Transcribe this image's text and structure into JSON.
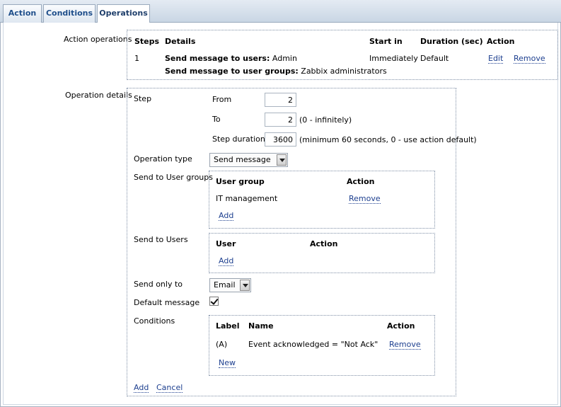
{
  "tabs": [
    {
      "label": "Action"
    },
    {
      "label": "Conditions"
    },
    {
      "label": "Operations"
    }
  ],
  "action_operations": {
    "label": "Action operations",
    "headers": {
      "steps": "Steps",
      "details": "Details",
      "start_in": "Start in",
      "duration": "Duration (sec)",
      "action": "Action"
    },
    "rows": [
      {
        "step": "1",
        "details_users_label": "Send message to users:",
        "details_users_value": "Admin",
        "details_groups_label": "Send message to user groups:",
        "details_groups_value": "Zabbix administrators",
        "start_in": "Immediately",
        "duration": "Default",
        "edit_label": "Edit",
        "remove_label": "Remove"
      }
    ]
  },
  "operation_details": {
    "label": "Operation details",
    "step_label": "Step",
    "from_label": "From",
    "from_value": "2",
    "to_label": "To",
    "to_value": "2",
    "to_hint": "(0 - infinitely)",
    "step_duration_label": "Step duration",
    "step_duration_value": "3600",
    "step_duration_hint": "(minimum 60 seconds, 0 - use action default)",
    "operation_type_label": "Operation type",
    "operation_type_value": "Send message",
    "send_to_user_groups_label": "Send to User groups",
    "user_groups": {
      "headers": {
        "group": "User group",
        "action": "Action"
      },
      "rows": [
        {
          "name": "IT management",
          "remove_label": "Remove"
        }
      ],
      "add_label": "Add"
    },
    "send_to_users_label": "Send to Users",
    "users": {
      "headers": {
        "user": "User",
        "action": "Action"
      },
      "add_label": "Add"
    },
    "send_only_to_label": "Send only to",
    "send_only_to_value": "Email",
    "default_message_label": "Default message",
    "default_message_checked": true,
    "conditions_label": "Conditions",
    "conditions": {
      "headers": {
        "label": "Label",
        "name": "Name",
        "action": "Action"
      },
      "rows": [
        {
          "label": "(A)",
          "name": "Event acknowledged = \"Not Ack\"",
          "remove_label": "Remove"
        }
      ],
      "new_label": "New"
    },
    "add_label": "Add",
    "cancel_label": "Cancel"
  }
}
